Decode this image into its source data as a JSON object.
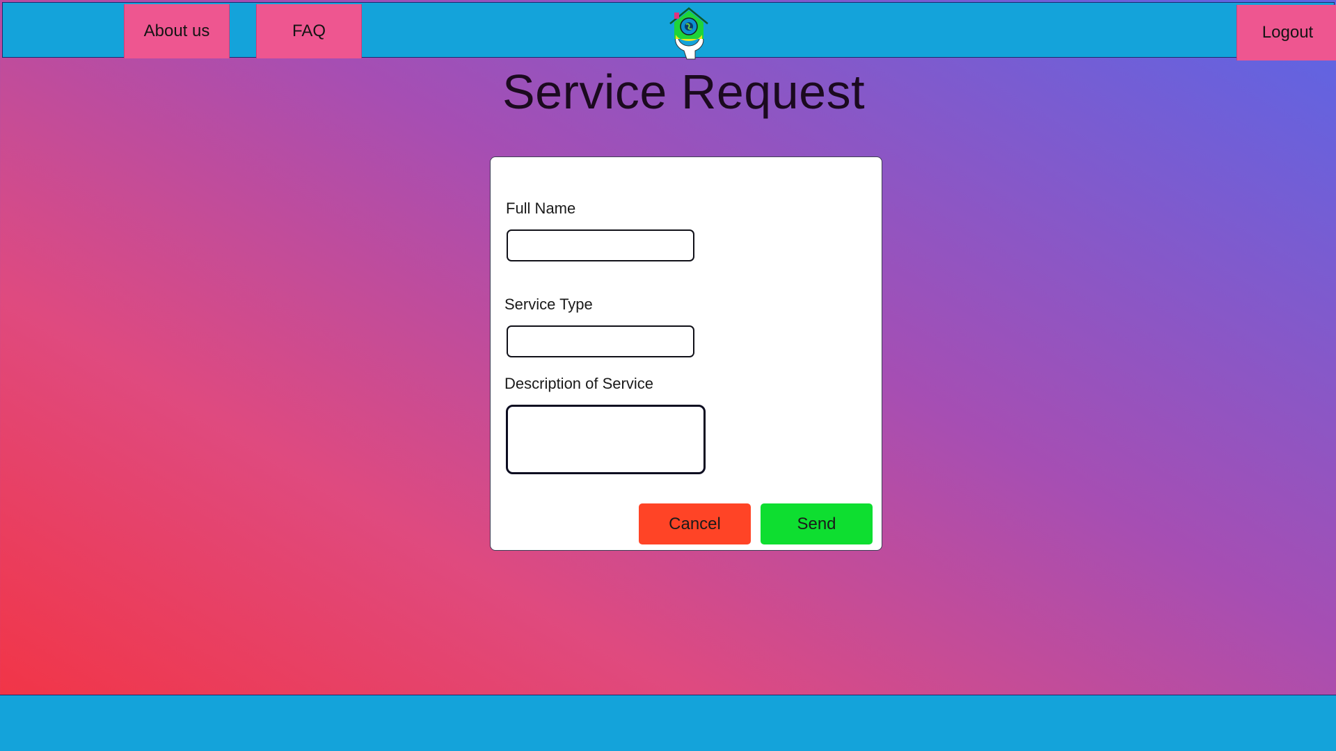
{
  "nav": {
    "about_label": "About us",
    "faq_label": "FAQ",
    "logout_label": "Logout"
  },
  "logo": {
    "icon": "house-in-hand-icon"
  },
  "page": {
    "title": "Service Request"
  },
  "form": {
    "full_name_label": "Full Name",
    "full_name_value": "",
    "service_type_label": "Service Type",
    "service_type_value": "",
    "description_label": "Description of Service",
    "description_value": "",
    "cancel_label": "Cancel",
    "send_label": "Send"
  },
  "colors": {
    "bar": "#14a3da",
    "nav_button": "#ee5690",
    "cancel": "#ff4426",
    "send": "#0ede30",
    "gradient_start": "#f4323f",
    "gradient_end": "#5a66e6"
  }
}
